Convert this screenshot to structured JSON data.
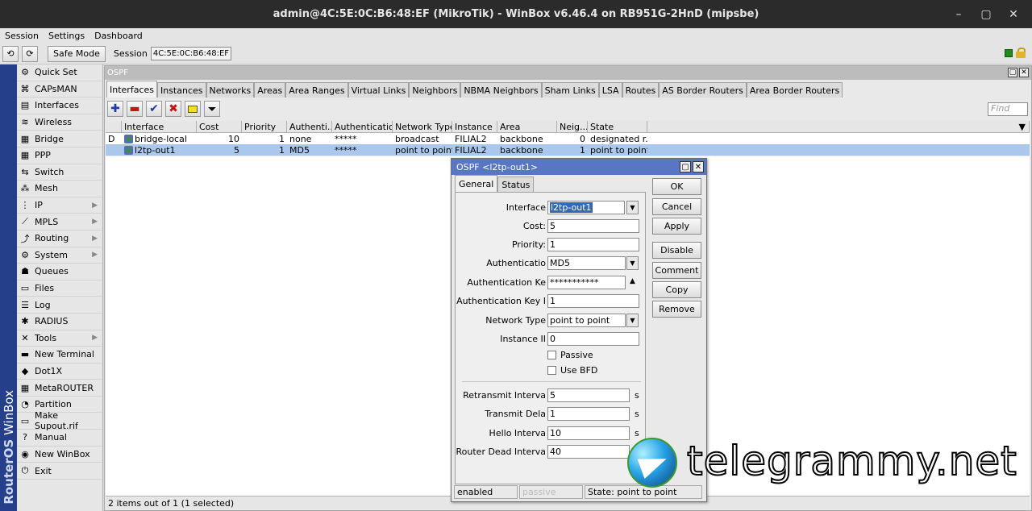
{
  "window_title": "admin@4C:5E:0C:B6:48:EF (MikroTik) - WinBox v6.46.4 on RB951G-2HnD (mipsbe)",
  "menu": [
    "Session",
    "Settings",
    "Dashboard"
  ],
  "toolbar": {
    "undo": "⟲",
    "redo": "⟳",
    "safe_mode": "Safe Mode",
    "session_label": "Session",
    "session_value": "4C:5E:0C:B6:48:EF"
  },
  "band": {
    "part1": "RouterOS",
    "part2": " WinBox"
  },
  "sidebar": [
    {
      "label": "Quick Set",
      "icon": "⚙",
      "arrow": false
    },
    {
      "label": "CAPsMAN",
      "icon": "⌘",
      "arrow": false
    },
    {
      "label": "Interfaces",
      "icon": "▤",
      "arrow": false
    },
    {
      "label": "Wireless",
      "icon": "≋",
      "arrow": false
    },
    {
      "label": "Bridge",
      "icon": "▦",
      "arrow": false
    },
    {
      "label": "PPP",
      "icon": "▦",
      "arrow": false
    },
    {
      "label": "Switch",
      "icon": "⇆",
      "arrow": false
    },
    {
      "label": "Mesh",
      "icon": "⁂",
      "arrow": false
    },
    {
      "label": "IP",
      "icon": "⋮",
      "arrow": true
    },
    {
      "label": "MPLS",
      "icon": "⟋",
      "arrow": true
    },
    {
      "label": "Routing",
      "icon": "⤴",
      "arrow": true
    },
    {
      "label": "System",
      "icon": "⚙",
      "arrow": true
    },
    {
      "label": "Queues",
      "icon": "☗",
      "arrow": false
    },
    {
      "label": "Files",
      "icon": "▭",
      "arrow": false
    },
    {
      "label": "Log",
      "icon": "☰",
      "arrow": false
    },
    {
      "label": "RADIUS",
      "icon": "✱",
      "arrow": false
    },
    {
      "label": "Tools",
      "icon": "✕",
      "arrow": true
    },
    {
      "label": "New Terminal",
      "icon": "▬",
      "arrow": false
    },
    {
      "label": "Dot1X",
      "icon": "◆",
      "arrow": false
    },
    {
      "label": "MetaROUTER",
      "icon": "▦",
      "arrow": false
    },
    {
      "label": "Partition",
      "icon": "◔",
      "arrow": false
    },
    {
      "label": "Make Supout.rif",
      "icon": "▭",
      "arrow": false
    },
    {
      "label": "Manual",
      "icon": "?",
      "arrow": false
    },
    {
      "label": "New WinBox",
      "icon": "◉",
      "arrow": false
    },
    {
      "label": "Exit",
      "icon": "⏻",
      "arrow": false
    }
  ],
  "ospf": {
    "title": "OSPF",
    "tabs": [
      "Interfaces",
      "Instances",
      "Networks",
      "Areas",
      "Area Ranges",
      "Virtual Links",
      "Neighbors",
      "NBMA Neighbors",
      "Sham Links",
      "LSA",
      "Routes",
      "AS Border Routers",
      "Area Border Routers"
    ],
    "find_placeholder": "Find",
    "columns": [
      "",
      "Interface",
      "Cost",
      "Priority",
      "Authenti...",
      "Authenticatio...",
      "Network Type",
      "Instance",
      "Area",
      "Neig...",
      "State"
    ],
    "rows": [
      {
        "flag": "D",
        "interface": "bridge-local",
        "cost": "10",
        "priority": "1",
        "auth": "none",
        "auth_key": "*****",
        "network_type": "broadcast",
        "instance": "FILIAL2",
        "area": "backbone",
        "neighbors": "0",
        "state": "designated r...",
        "selected": false
      },
      {
        "flag": "",
        "interface": "l2tp-out1",
        "cost": "5",
        "priority": "1",
        "auth": "MD5",
        "auth_key": "*****",
        "network_type": "point to point",
        "instance": "FILIAL2",
        "area": "backbone",
        "neighbors": "1",
        "state": "point to point",
        "selected": true
      }
    ],
    "status": "2 items out of 1 (1 selected)"
  },
  "dialog": {
    "title": "OSPF <l2tp-out1>",
    "tabs": [
      "General",
      "Status"
    ],
    "fields": {
      "interface": {
        "label": "Interface",
        "value": "l2tp-out1"
      },
      "cost": {
        "label": "Cost:",
        "value": "5"
      },
      "priority": {
        "label": "Priority:",
        "value": "1"
      },
      "authentication": {
        "label": "Authenticatio",
        "value": "MD5"
      },
      "auth_key": {
        "label": "Authentication Ke",
        "value": "***********"
      },
      "auth_key_id": {
        "label": "Authentication Key I",
        "value": "1"
      },
      "network_type": {
        "label": "Network Type",
        "value": "point to point"
      },
      "instance_id": {
        "label": "Instance II",
        "value": "0"
      },
      "passive": {
        "label": "Passive"
      },
      "use_bfd": {
        "label": "Use BFD"
      },
      "retransmit": {
        "label": "Retransmit Interva",
        "value": "5",
        "unit": "s"
      },
      "transmit_delay": {
        "label": "Transmit Dela",
        "value": "1",
        "unit": "s"
      },
      "hello": {
        "label": "Hello Interva",
        "value": "10",
        "unit": "s"
      },
      "dead": {
        "label": "Router Dead Interva",
        "value": "40",
        "unit": ""
      }
    },
    "buttons": [
      "OK",
      "Cancel",
      "Apply",
      "Disable",
      "Comment",
      "Copy",
      "Remove"
    ],
    "status": {
      "enabled": "enabled",
      "passive": "passive",
      "state": "State: point to point"
    }
  },
  "watermark": "telegrammy.net"
}
